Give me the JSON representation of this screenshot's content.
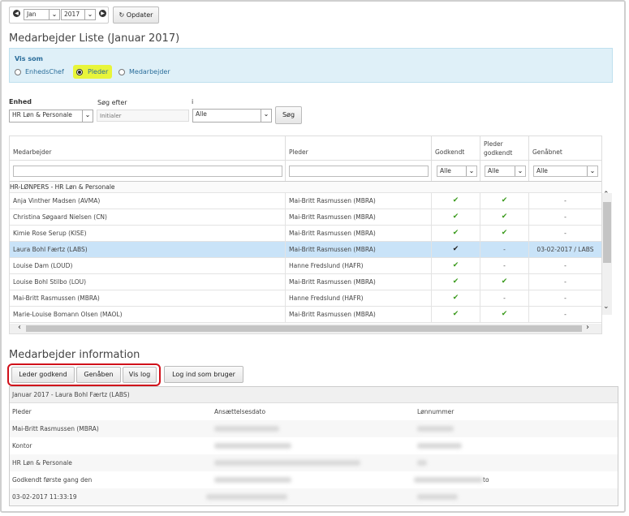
{
  "date": {
    "month": "Jan",
    "year": "2017",
    "refresh_label": "Opdater"
  },
  "page_title": "Medarbejder Liste (Januar 2017)",
  "vis_som": {
    "label": "Vis som",
    "options": [
      "EnhedsChef",
      "Pleder",
      "Medarbejder"
    ],
    "selected": "Pleder"
  },
  "filters": {
    "enhed_label": "Enhed",
    "enhed_value": "HR Løn & Personale",
    "search_label": "Søg efter",
    "search_placeholder": "Initialer",
    "in_label": "i",
    "in_value": "Alle",
    "search_button": "Søg"
  },
  "grid": {
    "headers": [
      "Medarbejder",
      "Pleder",
      "Godkendt",
      "Pleder godkendt",
      "Genåbnet"
    ],
    "filter_values": [
      "Alle",
      "Alle",
      "Alle"
    ],
    "group_label": "HR-LØNPERS - HR Løn & Personale",
    "rows": [
      {
        "name": "Anja Vinther Madsen (AVMA)",
        "pleder": "Mai-Britt Rasmussen (MBRA)",
        "godkendt": "✔",
        "pleder_godkendt": "✔",
        "genabnet": "-"
      },
      {
        "name": "Christina Søgaard Nielsen (CN)",
        "pleder": "Mai-Britt Rasmussen (MBRA)",
        "godkendt": "✔",
        "pleder_godkendt": "✔",
        "genabnet": "-"
      },
      {
        "name": "Kimie Rose Serup (KISE)",
        "pleder": "Mai-Britt Rasmussen (MBRA)",
        "godkendt": "✔",
        "pleder_godkendt": "✔",
        "genabnet": "-"
      },
      {
        "name": "Laura Bohl Færtz (LABS)",
        "pleder": "Mai-Britt Rasmussen (MBRA)",
        "godkendt": "✔",
        "pleder_godkendt": "-",
        "genabnet": "03-02-2017 / LABS"
      },
      {
        "name": "Louise Dam (LOUD)",
        "pleder": "Hanne Fredslund (HAFR)",
        "godkendt": "✔",
        "pleder_godkendt": "-",
        "genabnet": "-"
      },
      {
        "name": "Louise Bohl Stilbo (LOU)",
        "pleder": "Mai-Britt Rasmussen (MBRA)",
        "godkendt": "✔",
        "pleder_godkendt": "✔",
        "genabnet": "-"
      },
      {
        "name": "Mai-Britt Rasmussen (MBRA)",
        "pleder": "Hanne Fredslund (HAFR)",
        "godkendt": "✔",
        "pleder_godkendt": "-",
        "genabnet": "-"
      },
      {
        "name": "Marie-Louise Bomann Olsen (MAOL)",
        "pleder": "Mai-Britt Rasmussen (MBRA)",
        "godkendt": "✔",
        "pleder_godkendt": "✔",
        "genabnet": "-"
      }
    ],
    "selected_index": 3
  },
  "info": {
    "title": "Medarbejder information",
    "buttons": [
      "Leder godkend",
      "Genåben",
      "Vis log"
    ],
    "login_button": "Log ind som bruger",
    "panel_header": "Januar 2017 - Laura Bohl Færtz (LABS)",
    "col1_labels": [
      "Pleder",
      "Mai-Britt Rasmussen (MBRA)",
      "Kontor",
      "HR Løn & Personale",
      "Godkendt første gang den",
      "03-02-2017 11:33:19"
    ],
    "col2_header": "Ansættelsesdato",
    "col3_header": "Lønnummer",
    "col3_fragment": "to"
  },
  "colors": {
    "selected_row": "#c9e3f8",
    "highlight": "#e8f53a",
    "annotation": "#d0101a",
    "check": "#3a9a1c"
  }
}
